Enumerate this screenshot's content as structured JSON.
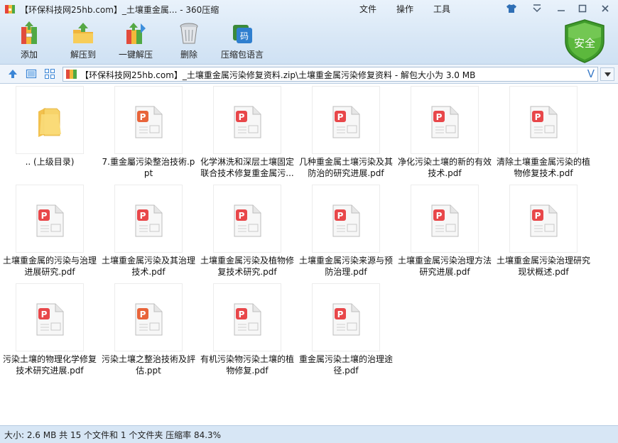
{
  "window": {
    "title": "【环保科技网25hb.com】_土壤重金属... - 360压缩",
    "menus": [
      "文件",
      "操作",
      "工具"
    ],
    "controls": [
      "shirt-icon",
      "menu-icon",
      "minimize-icon",
      "maximize-icon",
      "close-icon"
    ]
  },
  "toolbar": {
    "items": [
      {
        "label": "添加",
        "icon": "add-archive-icon"
      },
      {
        "label": "解压到",
        "icon": "extract-to-icon"
      },
      {
        "label": "一键解压",
        "icon": "one-click-extract-icon"
      },
      {
        "label": "删除",
        "icon": "delete-icon"
      },
      {
        "label": "压缩包语言",
        "icon": "archive-language-icon"
      }
    ],
    "security_badge": "安全"
  },
  "address": {
    "path": "【环保科技网25hb.com】_土壤重金属污染修复资料.zip\\土壤重金属污染修复资料 - 解包大小为 3.0 MB",
    "v_label": "V"
  },
  "files": [
    {
      "name": ".. (上级目录)",
      "type": "folder"
    },
    {
      "name": "7.重金屬污染整治技術.ppt",
      "type": "ppt"
    },
    {
      "name": "化学淋洗和深层土壤固定联合技术修复重金属污...",
      "type": "pdf"
    },
    {
      "name": "几种重金属土壤污染及其防治的研究进展.pdf",
      "type": "pdf"
    },
    {
      "name": "净化污染土壤的新的有效技术.pdf",
      "type": "pdf"
    },
    {
      "name": "清除土壤重金属污染的植物修复技术.pdf",
      "type": "pdf"
    },
    {
      "name": "土壤重金属的污染与治理进展研究.pdf",
      "type": "pdf"
    },
    {
      "name": "土壤重金属污染及其治理技术.pdf",
      "type": "pdf"
    },
    {
      "name": "土壤重金属污染及植物修复技术研究.pdf",
      "type": "pdf"
    },
    {
      "name": "土壤重金属污染来源与预防治理.pdf",
      "type": "pdf"
    },
    {
      "name": "土壤重金属污染治理方法研究进展.pdf",
      "type": "pdf"
    },
    {
      "name": "土壤重金属污染治理研究现状概述.pdf",
      "type": "pdf"
    },
    {
      "name": "污染土壤的物理化学修复技术研究进展.pdf",
      "type": "pdf"
    },
    {
      "name": "污染土壤之整治技術及評估.ppt",
      "type": "ppt"
    },
    {
      "name": "有机污染物污染土壤的植物修复.pdf",
      "type": "pdf"
    },
    {
      "name": "重金属污染土壤的治理途径.pdf",
      "type": "pdf"
    }
  ],
  "status": {
    "text": "大小: 2.6 MB 共 15 个文件和 1 个文件夹 压缩率 84.3%"
  },
  "colors": {
    "pdf_accent": "#e8474a",
    "ppt_accent": "#e8643a",
    "folder": "#f2c14e",
    "shield_green": "#4ca332",
    "address_v": "#3a7bc8"
  }
}
